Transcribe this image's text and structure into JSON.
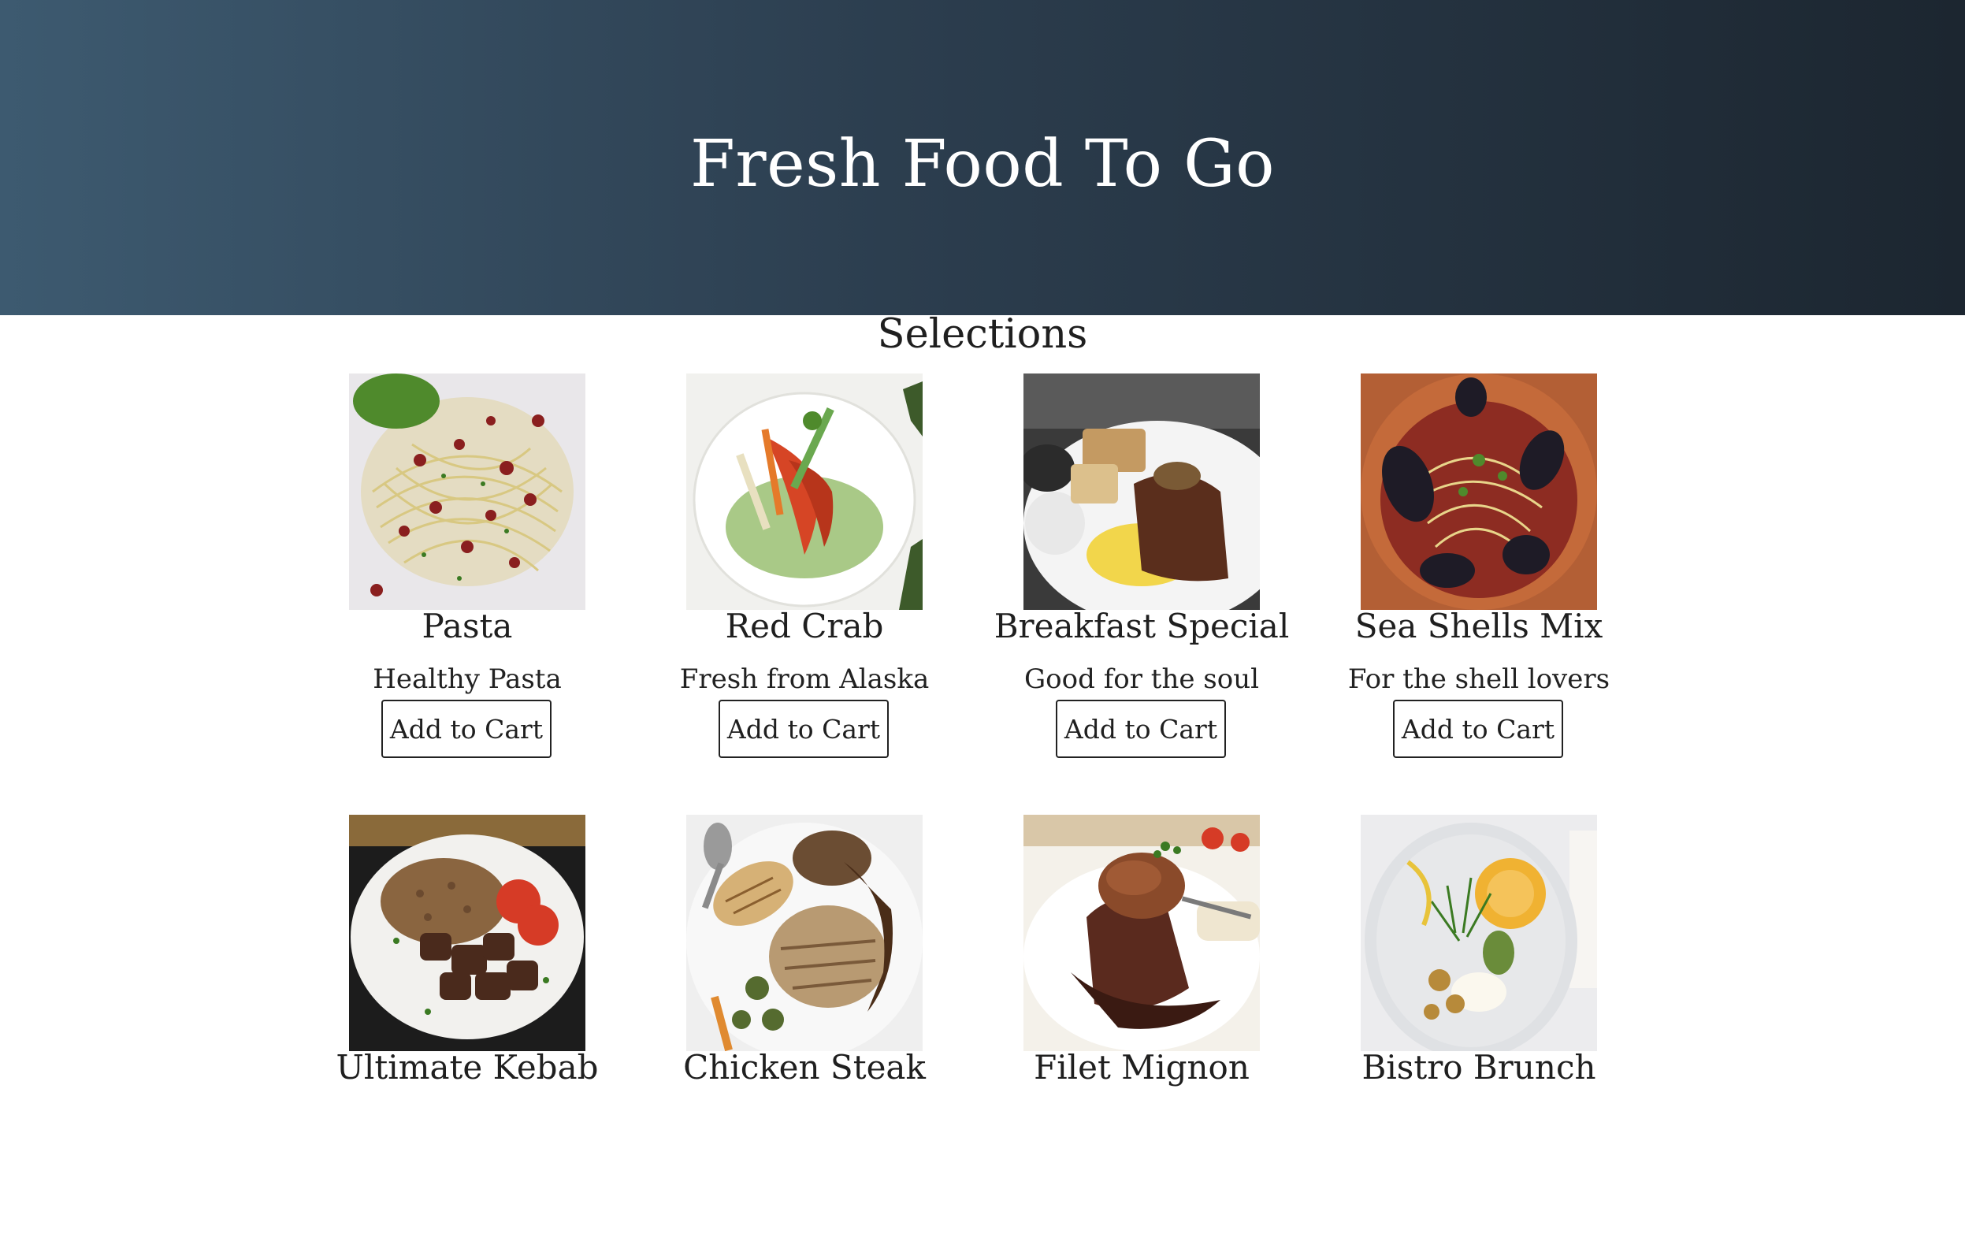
{
  "header": {
    "title": "Fresh Food To Go"
  },
  "selections": {
    "title": "Selections",
    "items": [
      {
        "name": "Pasta",
        "description": "Healthy Pasta",
        "button": "Add to Cart",
        "icon": "pasta-photo"
      },
      {
        "name": "Red Crab",
        "description": "Fresh from Alaska",
        "button": "Add to Cart",
        "icon": "red-crab-photo"
      },
      {
        "name": "Breakfast Special",
        "description": "Good for the soul",
        "button": "Add to Cart",
        "icon": "breakfast-special-photo"
      },
      {
        "name": "Sea Shells Mix",
        "description": "For the shell lovers",
        "button": "Add to Cart",
        "icon": "sea-shells-mix-photo"
      },
      {
        "name": "Ultimate Kebab",
        "icon": "ultimate-kebab-photo"
      },
      {
        "name": "Chicken Steak",
        "icon": "chicken-steak-photo"
      },
      {
        "name": "Filet Mignon",
        "icon": "filet-mignon-photo"
      },
      {
        "name": "Bistro Brunch",
        "icon": "bistro-brunch-photo"
      }
    ]
  },
  "colors": {
    "header_gradient_start": "#3d5a70",
    "header_gradient_end": "#1c2630",
    "background": "#ffffff",
    "text": "#1f1f1f"
  }
}
